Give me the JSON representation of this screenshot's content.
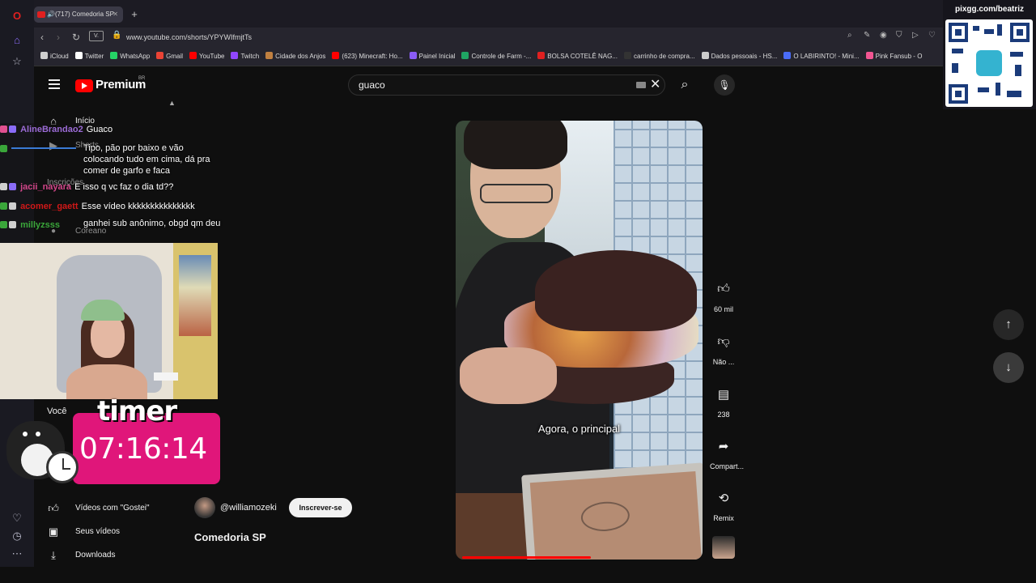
{
  "browser": {
    "tab_title": "(717) Comedoria SP",
    "url": "www.youtube.com/shorts/YPYWIfmjtTs",
    "ext_label": "V.",
    "bookmarks": [
      {
        "label": "iCloud",
        "color": "#cfcfcf"
      },
      {
        "label": "Twitter",
        "color": "#ffffff"
      },
      {
        "label": "WhatsApp",
        "color": "#25d366"
      },
      {
        "label": "Gmail",
        "color": "#ea4335"
      },
      {
        "label": "YouTube",
        "color": "#ff0000"
      },
      {
        "label": "Twitch",
        "color": "#9146ff"
      },
      {
        "label": "Cidade dos Anjos",
        "color": "#c08040"
      },
      {
        "label": "(623) Minecraft: Ho...",
        "color": "#ff0000"
      },
      {
        "label": "Painel Inicial",
        "color": "#8a5cf6"
      },
      {
        "label": "Controle de Farm -...",
        "color": "#1fa463"
      },
      {
        "label": "BOLSA COTELÊ NAG...",
        "color": "#e02020"
      },
      {
        "label": "carrinho de compra...",
        "color": "#333333"
      },
      {
        "label": "Dados pessoais - HS...",
        "color": "#cccccc"
      },
      {
        "label": "O LABIRINTO! - Mini...",
        "color": "#4a6cf7"
      },
      {
        "label": "Pink Fansub - O",
        "color": "#f25592"
      }
    ]
  },
  "youtube": {
    "logo_text": "Premium",
    "logo_region": "BR",
    "search": {
      "value": "guaco"
    },
    "sidebar": [
      {
        "label": "Início",
        "icon": "home-icon"
      },
      {
        "label": "Shorts",
        "icon": "shorts-icon"
      },
      {
        "label": "Inscrições",
        "icon": "subscriptions-icon"
      },
      {
        "label": "Coreano",
        "icon": "channel-icon"
      },
      {
        "label": "Você",
        "icon": "chevron-right-icon"
      },
      {
        "label": "Vídeos com \"Gostei\"",
        "icon": "thumbs-up-icon"
      },
      {
        "label": "Seus vídeos",
        "icon": "play-box-icon"
      },
      {
        "label": "Downloads",
        "icon": "download-icon"
      }
    ],
    "short": {
      "caption": "Agora, o principal",
      "progress": 0.52,
      "channel": "@williamozeki",
      "subscribe_label": "Inscrever-se",
      "title": "Comedoria SP"
    },
    "actions": {
      "like_count": "60 mil",
      "dislike_label": "Não ...",
      "comments_count": "238",
      "share_label": "Compart...",
      "remix_label": "Remix"
    }
  },
  "stream": {
    "chat": [
      {
        "user": "AlineBrandao2",
        "user_color": "#9b6bd6",
        "message": "Guaco"
      },
      {
        "user": "",
        "user_color": "#3a7bd5",
        "message": "Tipo, pão por baixo e vão colocando tudo em cima, dá pra comer de garfo e faca"
      },
      {
        "user": "jacii_nayara",
        "user_color": "#d2468a",
        "message": "E isso q vc faz o dia td??"
      },
      {
        "user": "acomer_gaett",
        "user_color": "#d01818",
        "message": "Esse vídeo kkkkkkkkkkkkkkk"
      },
      {
        "user": "millyzsss",
        "user_color": "#3aa63a",
        "message": "ganhei sub anônimo, obgd qm deu"
      }
    ],
    "timer_label": "timer",
    "timer_value": "07:16:14",
    "qr_url": "pixgg.com/beatriz"
  },
  "colors": {
    "accent_red": "#ff0000",
    "timer_pink": "#e0167a"
  }
}
